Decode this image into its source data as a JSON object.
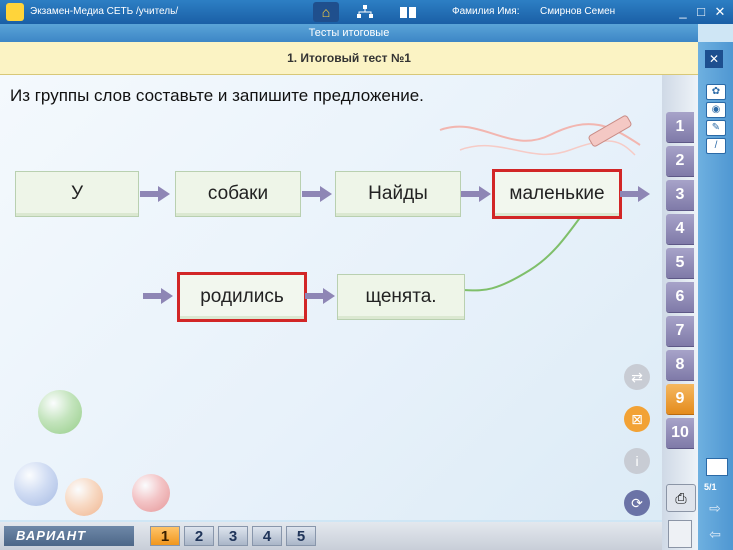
{
  "titlebar": {
    "app_title": "Экзамен-Медиа СЕТЬ /учитель/",
    "user_label": "Фамилия Имя:",
    "user_name": "Смирнов Семен"
  },
  "section": {
    "title": "Тесты итоговые"
  },
  "test": {
    "title": "1. Итоговый тест №1"
  },
  "task": {
    "instruction": "Из группы слов составьте и запишите предложение.",
    "words": [
      "У",
      "собаки",
      "Найды",
      "маленькие",
      "родились",
      "щенята."
    ]
  },
  "question_tabs": [
    "1",
    "2",
    "3",
    "4",
    "5",
    "6",
    "7",
    "8",
    "9",
    "10"
  ],
  "active_question": "9",
  "bottom": {
    "variant_label": "ВАРИАНТ",
    "variants": [
      "1",
      "2",
      "3",
      "4",
      "5"
    ],
    "active_variant": "1"
  },
  "counter": "5/1",
  "colors": {
    "selection": "#d22626",
    "active_tab": "#e48b1c",
    "title_bar": "#1a5fa6"
  }
}
